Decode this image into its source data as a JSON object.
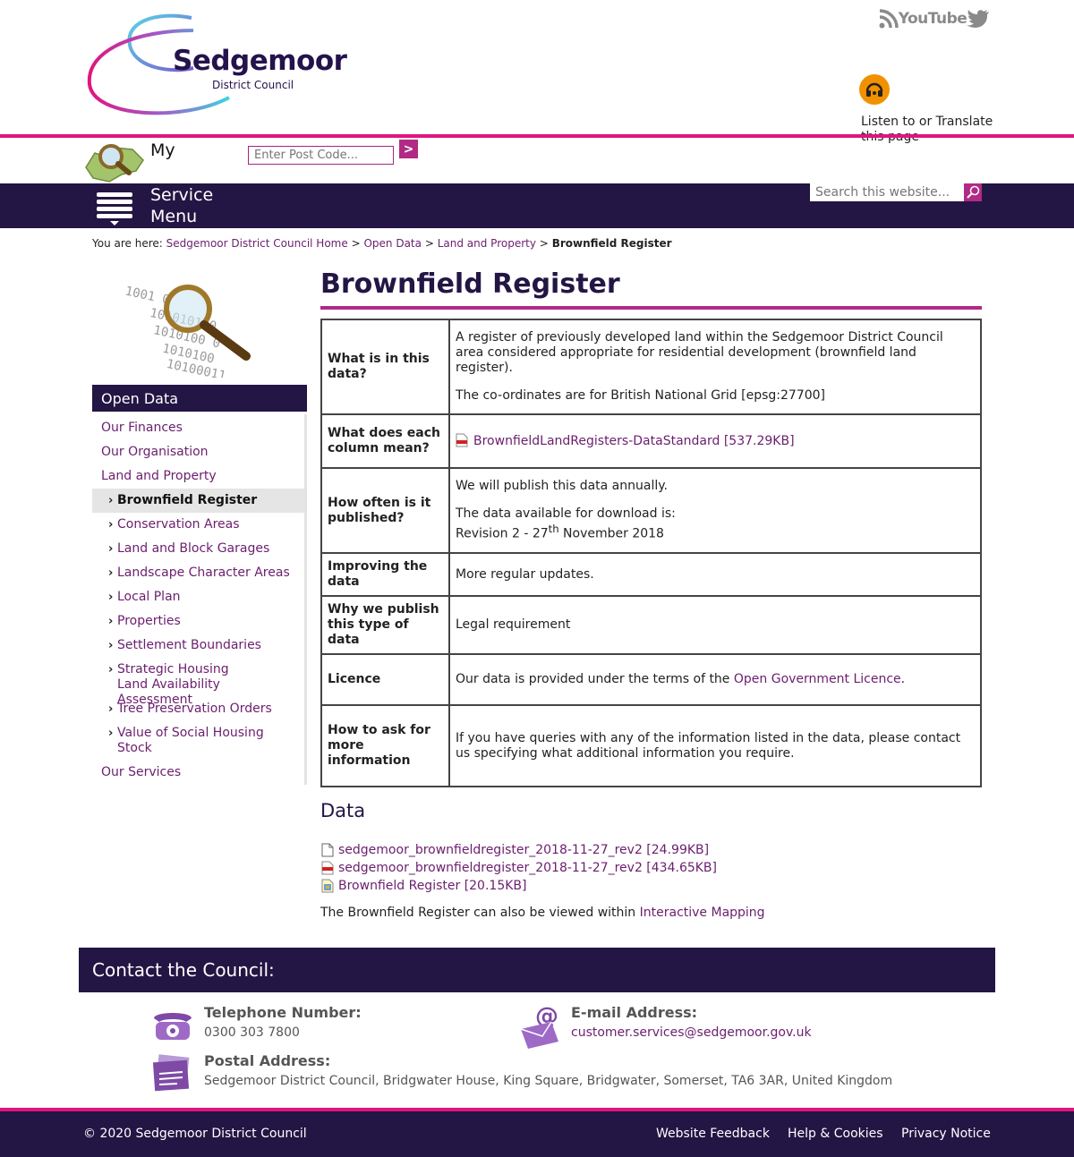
{
  "header": {
    "logo_name": "Sedgemoor",
    "logo_sub": "District Council",
    "social": [
      "rss-icon",
      "youtube-icon",
      "twitter-icon"
    ],
    "youtube_text": "YouTube",
    "listen_text": "Listen to or Translate this page"
  },
  "my_area": {
    "label": "My",
    "postcode_placeholder": "Enter Post Code...",
    "go": ">"
  },
  "nav": {
    "menu_label": "Service Menu",
    "search_placeholder": "Search this website..."
  },
  "breadcrumb": {
    "prefix": "You are here:",
    "items": [
      "Sedgemoor District Council Home",
      "Open Data",
      "Land and Property"
    ],
    "current": "Brownfield Register",
    "sep": ">"
  },
  "sidebar": {
    "heading": "Open Data",
    "items": [
      {
        "label": "Our Finances",
        "level": 1
      },
      {
        "label": "Our Organisation",
        "level": 1
      },
      {
        "label": "Land and Property",
        "level": 1
      },
      {
        "label": "Brownfield Register",
        "level": 2,
        "active": true
      },
      {
        "label": "Conservation Areas",
        "level": 2
      },
      {
        "label": "Land and Block Garages",
        "level": 2
      },
      {
        "label": "Landscape Character Areas",
        "level": 2
      },
      {
        "label": "Local Plan",
        "level": 2
      },
      {
        "label": "Properties",
        "level": 2
      },
      {
        "label": "Settlement Boundaries",
        "level": 2
      },
      {
        "label": "Strategic Housing Land Availability Assessment",
        "level": 2
      },
      {
        "label": "Tree Preservation Orders",
        "level": 2
      },
      {
        "label": "Value of Social Housing Stock",
        "level": 2
      },
      {
        "label": "Our Services",
        "level": 1
      }
    ]
  },
  "page": {
    "title": "Brownfield Register",
    "rows": {
      "what": {
        "k": "What is in this data?",
        "p1": "A register of previously developed land within the Sedgemoor District Council area considered appropriate for residential development (brownfield land register).",
        "p2": "The co-ordinates are for British National Grid [epsg:27700]"
      },
      "column": {
        "k": "What does each column mean?",
        "link": "BrownfieldLandRegisters-DataStandard [537.29KB]"
      },
      "often": {
        "k": "How often is it published?",
        "p1": "We will publish this data annually.",
        "p2": "The data available for download is:",
        "rev_a": "Revision 2 - 27",
        "rev_sup": "th",
        "rev_b": " November 2018"
      },
      "improving": {
        "k": "Improving the data",
        "v": "More regular updates."
      },
      "why": {
        "k": "Why we publish this type of data",
        "v": "Legal requirement"
      },
      "licence": {
        "k": "Licence",
        "v_pre": "Our data is provided under the terms of the ",
        "link": "Open Government Licence",
        "v_post": "."
      },
      "ask": {
        "k": "How to ask for more information",
        "v": "If you have queries with any of the information listed in the data, please contact us specifying what additional information you require."
      }
    },
    "data_heading": "Data",
    "files": [
      {
        "label": "sedgemoor_brownfieldregister_2018-11-27_rev2 [24.99KB]",
        "icon": "file-icon"
      },
      {
        "label": "sedgemoor_brownfieldregister_2018-11-27_rev2 [434.65KB]",
        "icon": "pdf-icon"
      },
      {
        "label": "Brownfield Register [20.15KB]",
        "icon": "map-file-icon"
      }
    ],
    "also_text": "The Brownfield Register can also be viewed within ",
    "also_link": "Interactive Mapping"
  },
  "contact": {
    "heading": "Contact the Council:",
    "phone_label": "Telephone Number:",
    "phone": "0300 303 7800",
    "email_label": "E-mail Address:",
    "email": "customer.services@sedgemoor.gov.uk",
    "post_label": "Postal Address:",
    "post": "Sedgemoor District Council, Bridgwater House, King Square, Bridgwater, Somerset, TA6 3AR, United Kingdom"
  },
  "footer": {
    "copyright": "© 2020 Sedgemoor District Council",
    "links": [
      "Website Feedback",
      "Help & Cookies",
      "Privacy Notice"
    ]
  },
  "colors": {
    "brand_dark": "#231544",
    "brand_pink": "#e0157f",
    "brand_purple": "#b12a85",
    "link": "#6b1e6e",
    "listen": "#f29100"
  }
}
